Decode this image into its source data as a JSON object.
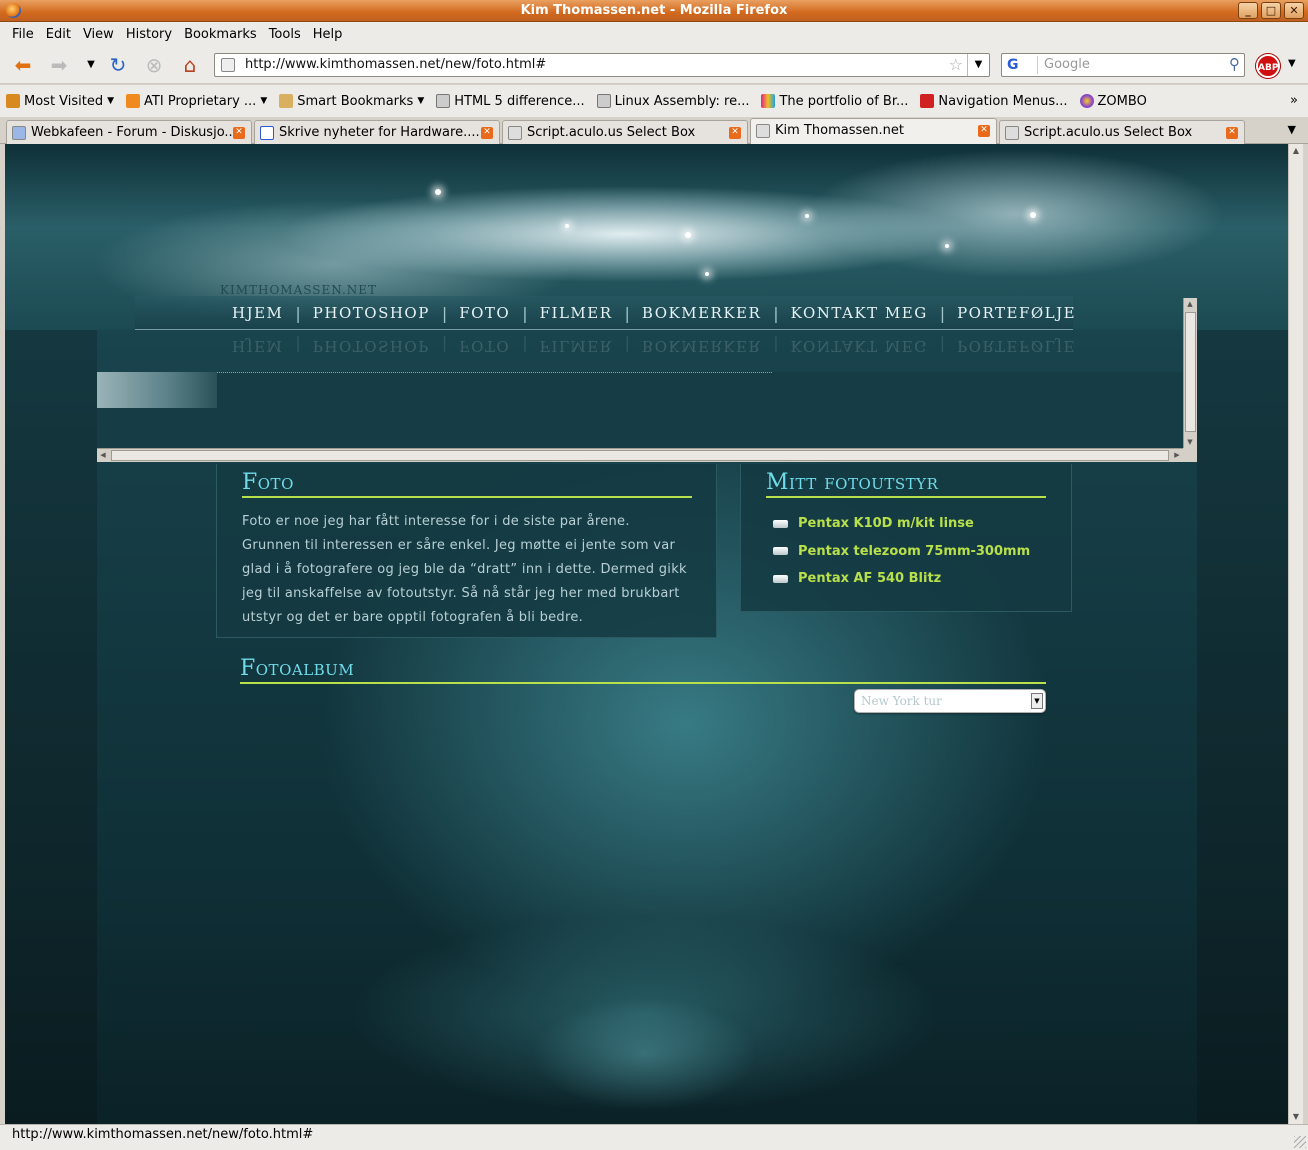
{
  "window": {
    "title": "Kim Thomassen.net - Mozilla Firefox"
  },
  "menubar": {
    "items": [
      "File",
      "Edit",
      "View",
      "History",
      "Bookmarks",
      "Tools",
      "Help"
    ]
  },
  "navbar": {
    "url": "http://www.kimthomassen.net/new/foto.html#",
    "search_placeholder": "Google",
    "search_engine_icon": "G",
    "adblock_label": "ABP"
  },
  "bookmarks": {
    "items": [
      {
        "label": "Most Visited",
        "icon": "most-visited-icon",
        "color": "#d88a20",
        "menu": true
      },
      {
        "label": "ATI Proprietary ...",
        "icon": "rss-icon",
        "color": "#f08a20",
        "menu": true
      },
      {
        "label": "Smart Bookmarks",
        "icon": "folder-icon",
        "color": "#d9b060",
        "menu": true
      },
      {
        "label": "HTML 5 difference...",
        "icon": "page-icon",
        "color": "#cccccc",
        "menu": false
      },
      {
        "label": "Linux Assembly: re...",
        "icon": "page-icon",
        "color": "#cccccc",
        "menu": false
      },
      {
        "label": "The portfolio of Br...",
        "icon": "portfolio-icon",
        "color": "#e02090",
        "menu": false
      },
      {
        "label": "Navigation Menus...",
        "icon": "smashing-icon",
        "color": "#d02020",
        "menu": false
      },
      {
        "label": "ZOMBO",
        "icon": "zombo-icon",
        "color": "#9040d0",
        "menu": false
      }
    ],
    "overflow": "»"
  },
  "tabs": [
    {
      "label": "Webkafeen - Forum - Diskusjo...",
      "active": false
    },
    {
      "label": "Skrive nyheter for Hardware....",
      "active": false
    },
    {
      "label": "Script.aculo.us Select Box",
      "active": false
    },
    {
      "label": "Kim Thomassen.net",
      "active": true
    },
    {
      "label": "Script.aculo.us Select Box",
      "active": false
    }
  ],
  "site": {
    "logo": "KIMTHOMASSEN.NET",
    "nav": [
      "HJEM",
      "PHOTOSHOP",
      "FOTO",
      "FILMER",
      "BOKMERKER",
      "KONTAKT MEG",
      "PORTEFØLJE"
    ],
    "nav_separator": "|",
    "foto": {
      "title": "Foto",
      "text": "Foto er noe jeg har fått interesse for i de siste par årene. Grunnen til interessen er såre enkel. Jeg møtte ei jente som var glad i å fotografere og jeg ble da “dratt” inn i dette. Dermed gikk jeg til anskaffelse av fotoutstyr. Så nå står jeg her med brukbart utstyr og det er bare opptil fotografen å bli bedre."
    },
    "utstyr": {
      "title": "Mitt fotoutstyr",
      "items": [
        "Pentax K10D m/kit linse",
        "Pentax telezoom 75mm-300mm",
        "Pentax AF 540 Blitz"
      ]
    },
    "album": {
      "title": "Fotoalbum",
      "selected": "New York tur"
    },
    "colors": {
      "accent": "#b8e04a",
      "heading": "#6fdcea",
      "background": "#173f48"
    }
  },
  "statusbar": {
    "text": "http://www.kimthomassen.net/new/foto.html#"
  }
}
